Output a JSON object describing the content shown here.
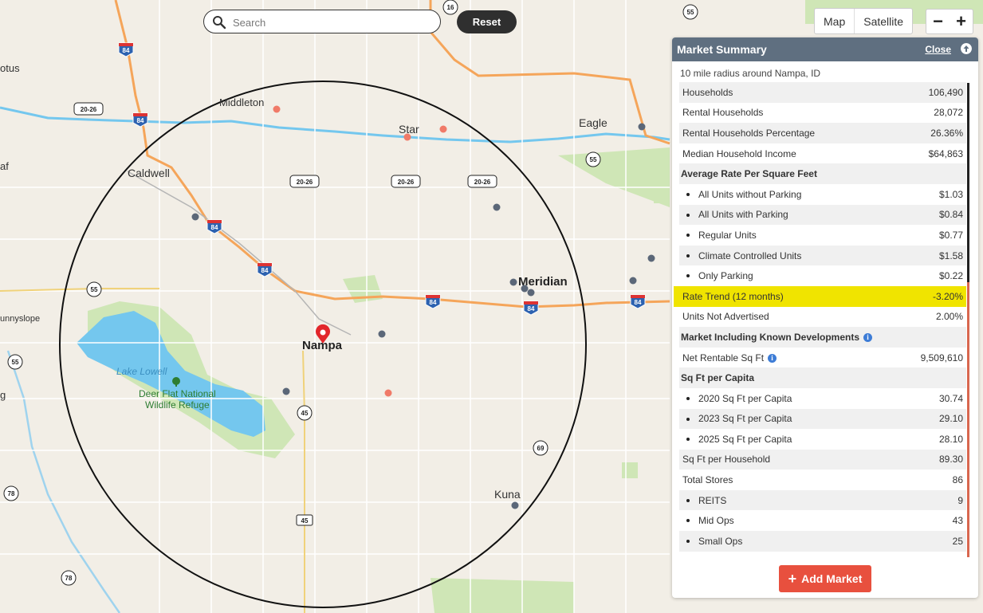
{
  "search": {
    "placeholder": "Search",
    "reset_label": "Reset"
  },
  "map_type": {
    "map_label": "Map",
    "satellite_label": "Satellite"
  },
  "zoom": {
    "out_label": "−",
    "in_label": "+"
  },
  "map_labels": {
    "middleton": "Middleton",
    "star": "Star",
    "eagle": "Eagle",
    "caldwell": "Caldwell",
    "meridian": "Meridian",
    "nampa": "Nampa",
    "kuna": "Kuna",
    "lake_lowell": "Lake Lowell",
    "refuge_line1": "Deer Flat National",
    "refuge_line2": "Wildlife Refuge",
    "sunnyslope": "unnyslope",
    "lotus": "otus",
    "af": "af",
    "g": "g"
  },
  "shields": {
    "i84": "84",
    "us20_26": "20-26",
    "r55": "55",
    "r45": "45",
    "r69": "69",
    "r78": "78",
    "r16": "16"
  },
  "panel": {
    "title": "Market Summary",
    "close_label": "Close",
    "subtitle": "10 mile radius around Nampa, ID",
    "rows": [
      {
        "label": "Households",
        "value": "106,490"
      },
      {
        "label": "Rental Households",
        "value": "28,072"
      },
      {
        "label": "Rental Households Percentage",
        "value": "26.36%"
      },
      {
        "label": "Median Household Income",
        "value": "$64,863"
      },
      {
        "label": "Average Rate Per Square Feet",
        "value": ""
      },
      {
        "label": "All Units without Parking",
        "value": "$1.03"
      },
      {
        "label": "All Units with Parking",
        "value": "$0.84"
      },
      {
        "label": "Regular Units",
        "value": "$0.77"
      },
      {
        "label": "Climate Controlled Units",
        "value": "$1.58"
      },
      {
        "label": "Only Parking",
        "value": "$0.22"
      },
      {
        "label": "Rate Trend (12 months)",
        "value": "-3.20%"
      },
      {
        "label": "Units Not Advertised",
        "value": "2.00%"
      },
      {
        "label": "Market Including Known Developments",
        "value": ""
      },
      {
        "label": "Net Rentable Sq Ft",
        "value": "9,509,610"
      },
      {
        "label": "Sq Ft per Capita",
        "value": ""
      },
      {
        "label": "2020 Sq Ft per Capita",
        "value": "30.74"
      },
      {
        "label": "2023 Sq Ft per Capita",
        "value": "29.10"
      },
      {
        "label": "2025 Sq Ft per Capita",
        "value": "28.10"
      },
      {
        "label": "Sq Ft per Household",
        "value": "89.30"
      },
      {
        "label": "Total Stores",
        "value": "86"
      },
      {
        "label": "REITS",
        "value": "9"
      },
      {
        "label": "Mid Ops",
        "value": "43"
      },
      {
        "label": "Small Ops",
        "value": "25"
      }
    ],
    "add_market_label": "Add Market"
  }
}
